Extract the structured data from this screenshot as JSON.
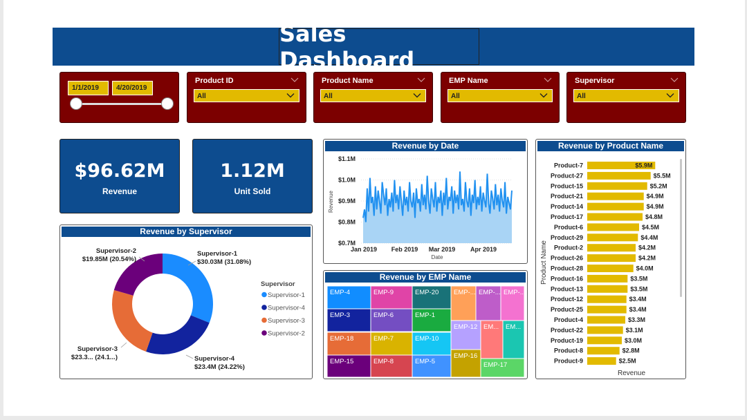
{
  "header": {
    "title": "Sales Dashboard"
  },
  "filters": {
    "date_start": "1/1/2019",
    "date_end": "4/20/2019",
    "product_id": {
      "label": "Product ID",
      "value": "All"
    },
    "product_name": {
      "label": "Product Name",
      "value": "All"
    },
    "emp_name": {
      "label": "EMP Name",
      "value": "All"
    },
    "supervisor": {
      "label": "Supervisor",
      "value": "All"
    },
    "date_slider_range": [
      0,
      1
    ]
  },
  "kpis": {
    "revenue": {
      "value": "$96.62M",
      "label": "Revenue"
    },
    "units": {
      "value": "1.12M",
      "label": "Unit Sold"
    }
  },
  "colors": {
    "header_blue": "#0d4c8f",
    "slicer_red": "#7c0000",
    "slicer_gold": "#e2ba00",
    "bar_gold": "#e2ba00",
    "area_blue": "#a9d4f5",
    "line_blue": "#2191f0"
  },
  "chart_data": [
    {
      "type": "line",
      "title": "Revenue by Date",
      "xlabel": "Date",
      "ylabel": "Revenue",
      "ylim": [
        0.7,
        1.1
      ],
      "yticks": [
        "$0.7M",
        "$0.8M",
        "$0.9M",
        "$1.0M",
        "$1.1M"
      ],
      "xticks": [
        "Jan 2019",
        "Feb 2019",
        "Mar 2019",
        "Apr 2019"
      ],
      "x_range": [
        "2019-01-01",
        "2019-04-20"
      ],
      "values_in_millions": [
        0.82,
        0.86,
        0.8,
        0.96,
        0.85,
        1.01,
        0.89,
        0.92,
        0.83,
        0.97,
        0.86,
        0.95,
        0.9,
        0.84,
        0.99,
        0.93,
        0.88,
        0.96,
        0.83,
        0.91,
        0.87,
        0.94,
        0.85,
        1.0,
        0.89,
        0.93,
        0.86,
        0.97,
        0.9,
        0.83,
        0.95,
        0.88,
        0.92,
        0.85,
        0.99,
        0.9,
        0.87,
        0.94,
        0.82,
        0.96,
        0.89,
        0.91,
        0.85,
        0.98,
        0.88,
        0.93,
        0.86,
        1.02,
        0.9,
        0.84,
        0.96,
        0.91,
        0.87,
        0.99,
        0.85,
        0.92,
        0.89,
        0.95,
        0.83,
        0.94,
        0.88,
        1.01,
        0.86,
        0.92,
        0.9,
        0.97,
        0.84,
        0.95,
        0.89,
        0.93,
        0.86,
        1.04,
        0.88,
        0.91,
        0.85,
        0.99,
        0.9,
        0.87,
        0.96,
        0.83,
        0.93,
        0.89,
        1.0,
        0.86,
        0.92,
        0.88,
        0.97,
        0.85,
        0.94,
        0.9,
        0.87,
        1.03,
        0.89,
        0.84,
        0.95,
        0.91,
        0.86,
        0.98,
        0.88,
        0.93,
        0.85,
        0.96,
        0.9,
        0.87,
        0.99,
        0.84,
        0.92,
        0.89,
        0.86,
        0.95
      ],
      "fill_color": "#a9d4f5",
      "line_color": "#2191f0"
    },
    {
      "type": "pie",
      "title": "Revenue by Supervisor",
      "legend_title": "Supervisor",
      "legend_position": "right",
      "slices": [
        {
          "name": "Supervisor-1",
          "value": 30.03,
          "pct": 31.08,
          "label1": "Supervisor-1",
          "label2": "$30.03M (31.08%)",
          "color": "#1a8cff"
        },
        {
          "name": "Supervisor-4",
          "value": 23.4,
          "pct": 24.22,
          "label1": "Supervisor-4",
          "label2": "$23.4M (24.22%)",
          "color": "#12239e"
        },
        {
          "name": "Supervisor-3",
          "value": 23.34,
          "pct": 24.16,
          "label1": "Supervisor-3",
          "label2": "$23.3... (24.1...)",
          "color": "#e66c37"
        },
        {
          "name": "Supervisor-2",
          "value": 19.85,
          "pct": 20.54,
          "label1": "Supervisor-2",
          "label2": "$19.85M (20.54%)",
          "color": "#6b007b"
        }
      ]
    },
    {
      "type": "treemap",
      "title": "Revenue by EMP Name",
      "cells": [
        {
          "name": "EMP-4",
          "color": "#118dff"
        },
        {
          "name": "EMP-3",
          "color": "#12239e"
        },
        {
          "name": "EMP-18",
          "color": "#e66c37"
        },
        {
          "name": "EMP-15",
          "color": "#6b007b"
        },
        {
          "name": "EMP-9",
          "color": "#e044a7"
        },
        {
          "name": "EMP-6",
          "color": "#744ec2"
        },
        {
          "name": "EMP-7",
          "color": "#d9b300"
        },
        {
          "name": "EMP-8",
          "color": "#d64550"
        },
        {
          "name": "EMP-20",
          "color": "#197278"
        },
        {
          "name": "EMP-1",
          "color": "#1aab40"
        },
        {
          "name": "EMP-10",
          "color": "#15c6f4"
        },
        {
          "name": "EMP-5",
          "color": "#4092ff"
        },
        {
          "name": "EMP-...",
          "color": "#ffa058"
        },
        {
          "name": "EMP-...",
          "color": "#be5dc9"
        },
        {
          "name": "EMP-...",
          "color": "#f472d0"
        },
        {
          "name": "EMP-12",
          "color": "#b5a1ff"
        },
        {
          "name": "EM...",
          "color": "#ff7979"
        },
        {
          "name": "EM...",
          "color": "#1bc6b1"
        },
        {
          "name": "EMP-16",
          "color": "#c4a200"
        },
        {
          "name": "EMP-17",
          "color": "#5bd667"
        }
      ]
    },
    {
      "type": "bar",
      "orientation": "horizontal",
      "title": "Revenue by Product Name",
      "xlabel": "Revenue",
      "ylabel": "Product Name",
      "categories": [
        "Product-7",
        "Product-27",
        "Product-15",
        "Product-21",
        "Product-14",
        "Product-17",
        "Product-6",
        "Product-29",
        "Product-2",
        "Product-26",
        "Product-28",
        "Product-16",
        "Product-13",
        "Product-12",
        "Product-25",
        "Product-4",
        "Product-22",
        "Product-19",
        "Product-8",
        "Product-9"
      ],
      "values": [
        5.9,
        5.5,
        5.2,
        4.9,
        4.9,
        4.8,
        4.5,
        4.4,
        4.2,
        4.2,
        4.0,
        3.5,
        3.5,
        3.4,
        3.4,
        3.3,
        3.1,
        3.0,
        2.8,
        2.5
      ],
      "labels": [
        "$5.9M",
        "$5.5M",
        "$5.2M",
        "$4.9M",
        "$4.9M",
        "$4.8M",
        "$4.5M",
        "$4.4M",
        "$4.2M",
        "$4.2M",
        "$4.0M",
        "$3.5M",
        "$3.5M",
        "$3.4M",
        "$3.4M",
        "$3.3M",
        "$3.1M",
        "$3.0M",
        "$2.8M",
        "$2.5M"
      ],
      "color": "#e2ba00"
    }
  ]
}
